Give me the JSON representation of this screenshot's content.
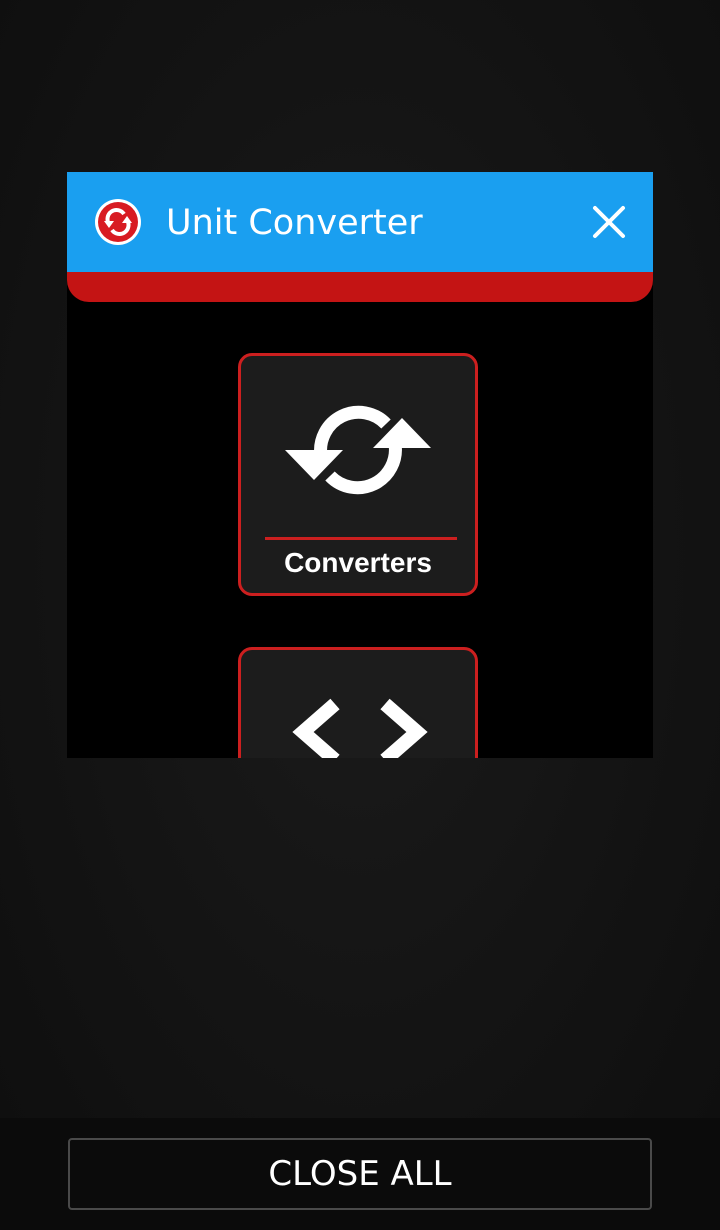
{
  "recent_app": {
    "title": "Unit Converter",
    "icon": "sync-arrows-icon",
    "close_icon": "close-icon"
  },
  "preview": {
    "tiles": [
      {
        "label": "Converters",
        "icon": "sync-arrows-icon"
      },
      {
        "label": "",
        "icon": "code-brackets-icon"
      }
    ]
  },
  "footer": {
    "close_all_label": "CLOSE ALL"
  },
  "colors": {
    "header": "#1a9ff0",
    "accent_red": "#cc1f1f",
    "strip_red": "#c41414",
    "background": "#141414"
  }
}
